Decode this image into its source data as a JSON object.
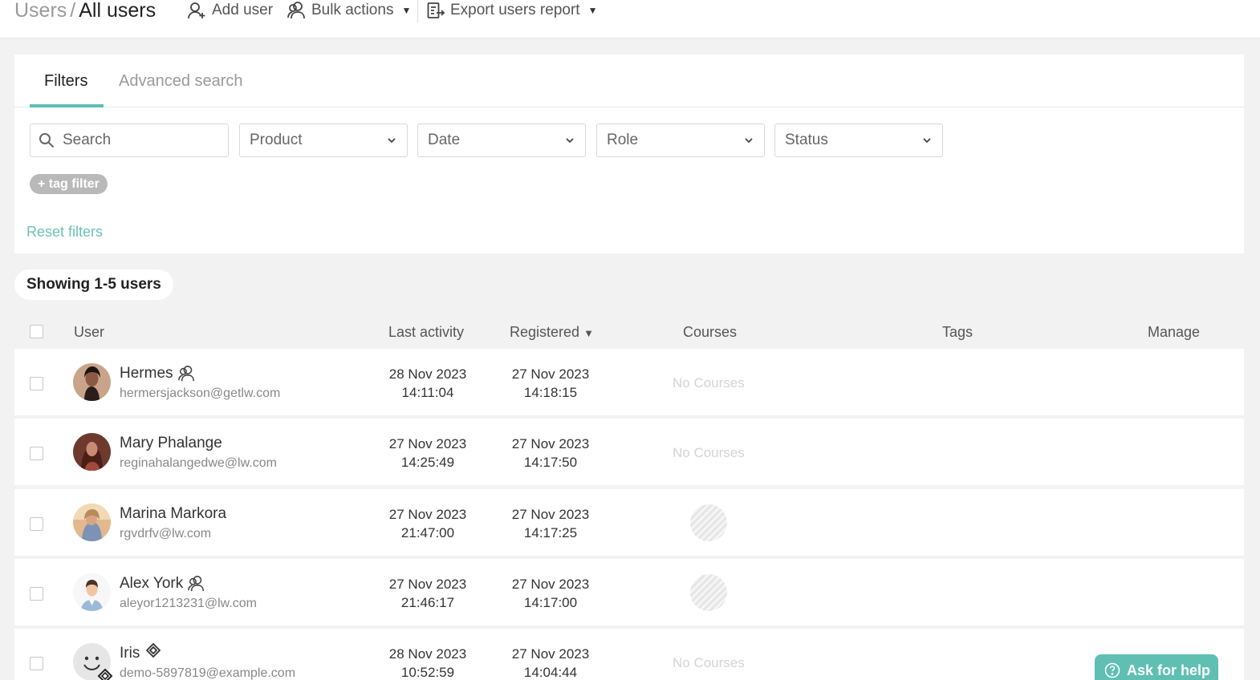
{
  "header": {
    "breadcrumb_parent": "Users",
    "breadcrumb_sep": "/",
    "breadcrumb_current": "All users",
    "add_user": "Add user",
    "bulk_actions": "Bulk actions",
    "export": "Export users report"
  },
  "filters": {
    "tabs": [
      "Filters",
      "Advanced search"
    ],
    "search_placeholder": "Search",
    "product": "Product",
    "date": "Date",
    "role": "Role",
    "status": "Status",
    "tag_filter": "+ tag filter",
    "reset": "Reset filters"
  },
  "table": {
    "showing": "Showing 1-5 users",
    "columns": {
      "user": "User",
      "last_activity": "Last activity",
      "registered": "Registered",
      "sort_indicator": "▼",
      "courses": "Courses",
      "tags": "Tags",
      "manage": "Manage"
    },
    "rows": [
      {
        "name": "Hermes",
        "email": "hermersjackson@getlw.com",
        "last_activity_date": "28 Nov 2023",
        "last_activity_time": "14:11:04",
        "registered_date": "27 Nov 2023",
        "registered_time": "14:18:15",
        "courses": "No Courses"
      },
      {
        "name": "Mary Phalange",
        "email": "reginahalangedwe@lw.com",
        "last_activity_date": "27 Nov 2023",
        "last_activity_time": "14:25:49",
        "registered_date": "27 Nov 2023",
        "registered_time": "14:17:50",
        "courses": "No Courses"
      },
      {
        "name": "Marina Markora",
        "email": "rgvdrfv@lw.com",
        "last_activity_date": "27 Nov 2023",
        "last_activity_time": "21:47:00",
        "registered_date": "27 Nov 2023",
        "registered_time": "14:17:25",
        "courses": ""
      },
      {
        "name": "Alex York",
        "email": "aleyor1213231@lw.com",
        "last_activity_date": "27 Nov 2023",
        "last_activity_time": "21:46:17",
        "registered_date": "27 Nov 2023",
        "registered_time": "14:17:00",
        "courses": ""
      },
      {
        "name": "Iris",
        "email": "demo-5897819@example.com",
        "last_activity_date": "28 Nov 2023",
        "last_activity_time": "10:52:59",
        "registered_date": "27 Nov 2023",
        "registered_time": "14:04:44",
        "courses": "No Courses"
      }
    ]
  },
  "help": {
    "label": "Ask for help"
  },
  "colors": {
    "accent": "#5fbfb3",
    "link": "#6cc2b8",
    "tag_filter_bg": "#b9b9b9"
  },
  "icons": {
    "add_user": "user-plus-icon",
    "bulk_actions": "users-icon",
    "export": "export-report-icon",
    "search": "search-icon",
    "select_chevron": "chevron-down-icon",
    "sort": "sort-desc-icon",
    "instructor_badge": "users-icon",
    "diamond_badge": "diamond-badge-icon",
    "help": "question-circle-icon"
  }
}
